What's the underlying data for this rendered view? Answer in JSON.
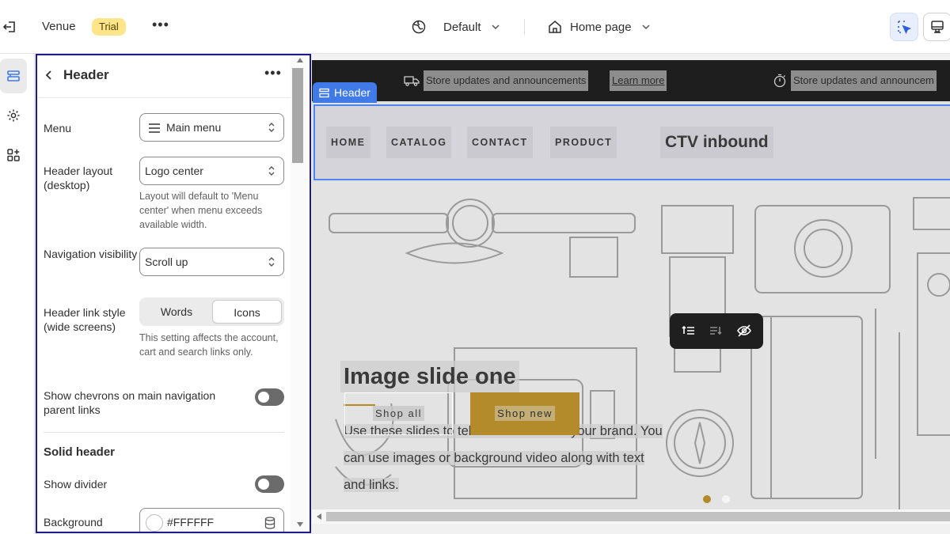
{
  "topbar": {
    "store_name": "Venue",
    "badge": "Trial",
    "more": "•••",
    "theme_label": "Default",
    "page_label": "Home page",
    "icons": [
      "exit-icon",
      "globe-icon",
      "home-icon",
      "chevron-down-icon",
      "inspector-icon",
      "desktop-icon"
    ]
  },
  "rail": {
    "items": [
      "sections-icon",
      "gear-icon",
      "apps-icon"
    ]
  },
  "panel": {
    "title": "Header",
    "more": "•••",
    "menu_label": "Menu",
    "menu_value": "Main menu",
    "layout_label": "Header layout (desktop)",
    "layout_value": "Logo center",
    "layout_help": "Layout will default to 'Menu center' when menu exceeds available width.",
    "nav_vis_label": "Navigation visibility",
    "nav_vis_value": "Scroll up",
    "link_style_label": "Header link style (wide screens)",
    "link_style_options": [
      "Words",
      "Icons"
    ],
    "link_style_selected": "Icons",
    "link_style_help": "This setting affects the account, cart and search links only.",
    "chevrons_label": "Show chevrons on main navigation parent links",
    "chevrons_on": false,
    "solid_header_title": "Solid header",
    "divider_label": "Show divider",
    "divider_on": false,
    "background_label": "Background",
    "background_value": "#FFFFFF"
  },
  "preview": {
    "announcements": [
      {
        "text": "Store updates and announcements",
        "link": "Learn more",
        "icon": "truck-icon"
      },
      {
        "text": "Store updates and announcem",
        "icon": "stopwatch-icon"
      }
    ],
    "header_tag": "Header",
    "nav": [
      "HOME",
      "CATALOG",
      "CONTACT",
      "PRODUCT"
    ],
    "logo": "CTV inbound",
    "hero": {
      "title": "Image slide one",
      "text_lines": [
        "Use these slides to tell the world about your brand. You",
        "can use images or background video along with text",
        "and links."
      ],
      "button_primary": "Shop all",
      "button_secondary": "Shop new"
    },
    "slides": 2,
    "active_slide": 1
  },
  "colors": {
    "accent": "#3f7ae8",
    "gold": "#b38b2a",
    "panel_border": "#1f1a8a",
    "trial_badge": "#ffe58a"
  }
}
